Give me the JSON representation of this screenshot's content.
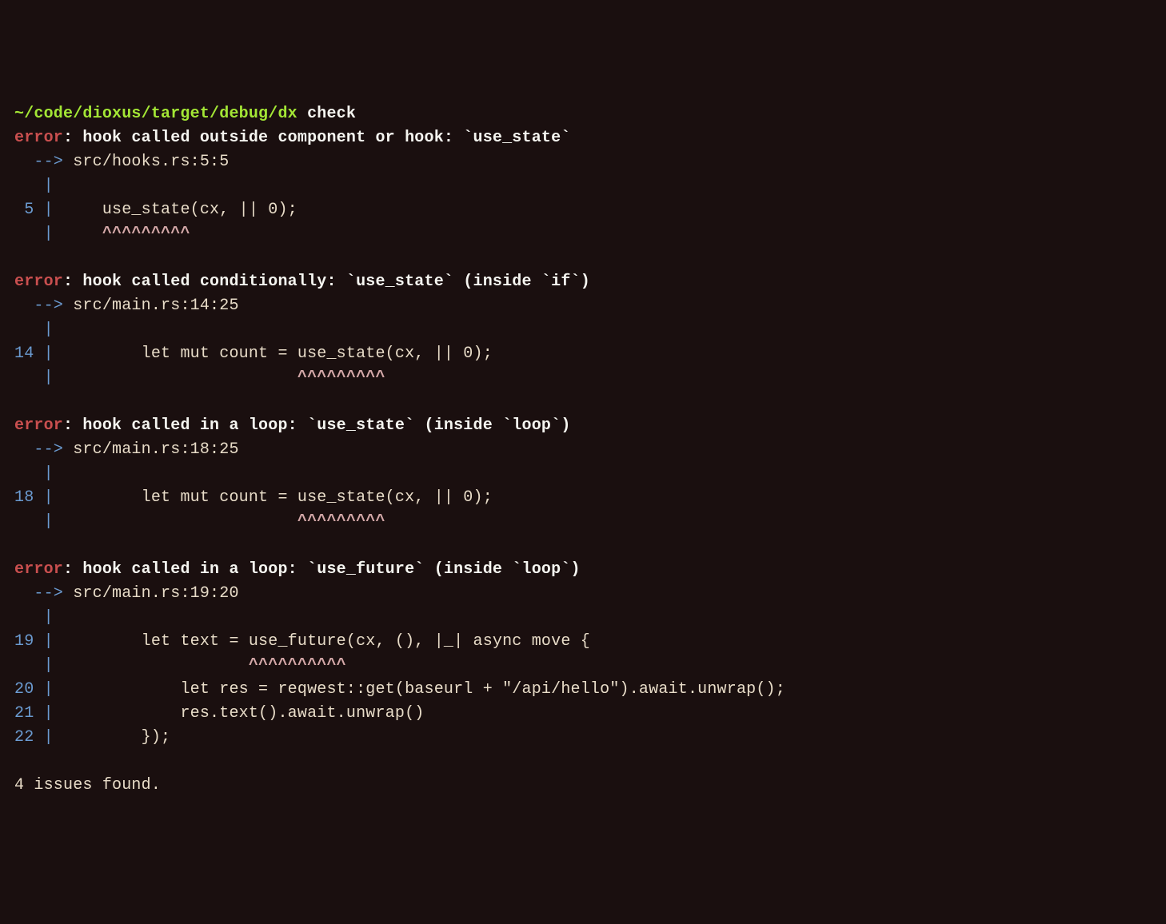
{
  "prompt": {
    "path": "~/code/dioxus/target/debug/dx",
    "command": "check"
  },
  "errors": [
    {
      "label": "error",
      "message": "hook called outside component or hook: `use_state`",
      "location": "src/hooks.rs:5:5",
      "lines": [
        {
          "num": "5",
          "code": "    use_state(cx, || 0);",
          "carets": "    ^^^^^^^^^"
        }
      ]
    },
    {
      "label": "error",
      "message": "hook called conditionally: `use_state` (inside `if`)",
      "location": "src/main.rs:14:25",
      "lines": [
        {
          "num": "14",
          "code": "        let mut count = use_state(cx, || 0);",
          "carets": "                        ^^^^^^^^^"
        }
      ]
    },
    {
      "label": "error",
      "message": "hook called in a loop: `use_state` (inside `loop`)",
      "location": "src/main.rs:18:25",
      "lines": [
        {
          "num": "18",
          "code": "        let mut count = use_state(cx, || 0);",
          "carets": "                        ^^^^^^^^^"
        }
      ]
    },
    {
      "label": "error",
      "message": "hook called in a loop: `use_future` (inside `loop`)",
      "location": "src/main.rs:19:20",
      "lines": [
        {
          "num": "19",
          "code": "        let text = use_future(cx, (), |_| async move {",
          "carets": "                   ^^^^^^^^^^"
        },
        {
          "num": "20",
          "code": "            let res = reqwest::get(baseurl + \"/api/hello\").await.unwrap();",
          "carets": null
        },
        {
          "num": "21",
          "code": "            res.text().await.unwrap()",
          "carets": null
        },
        {
          "num": "22",
          "code": "        });",
          "carets": null
        }
      ]
    }
  ],
  "summary": "4 issues found."
}
